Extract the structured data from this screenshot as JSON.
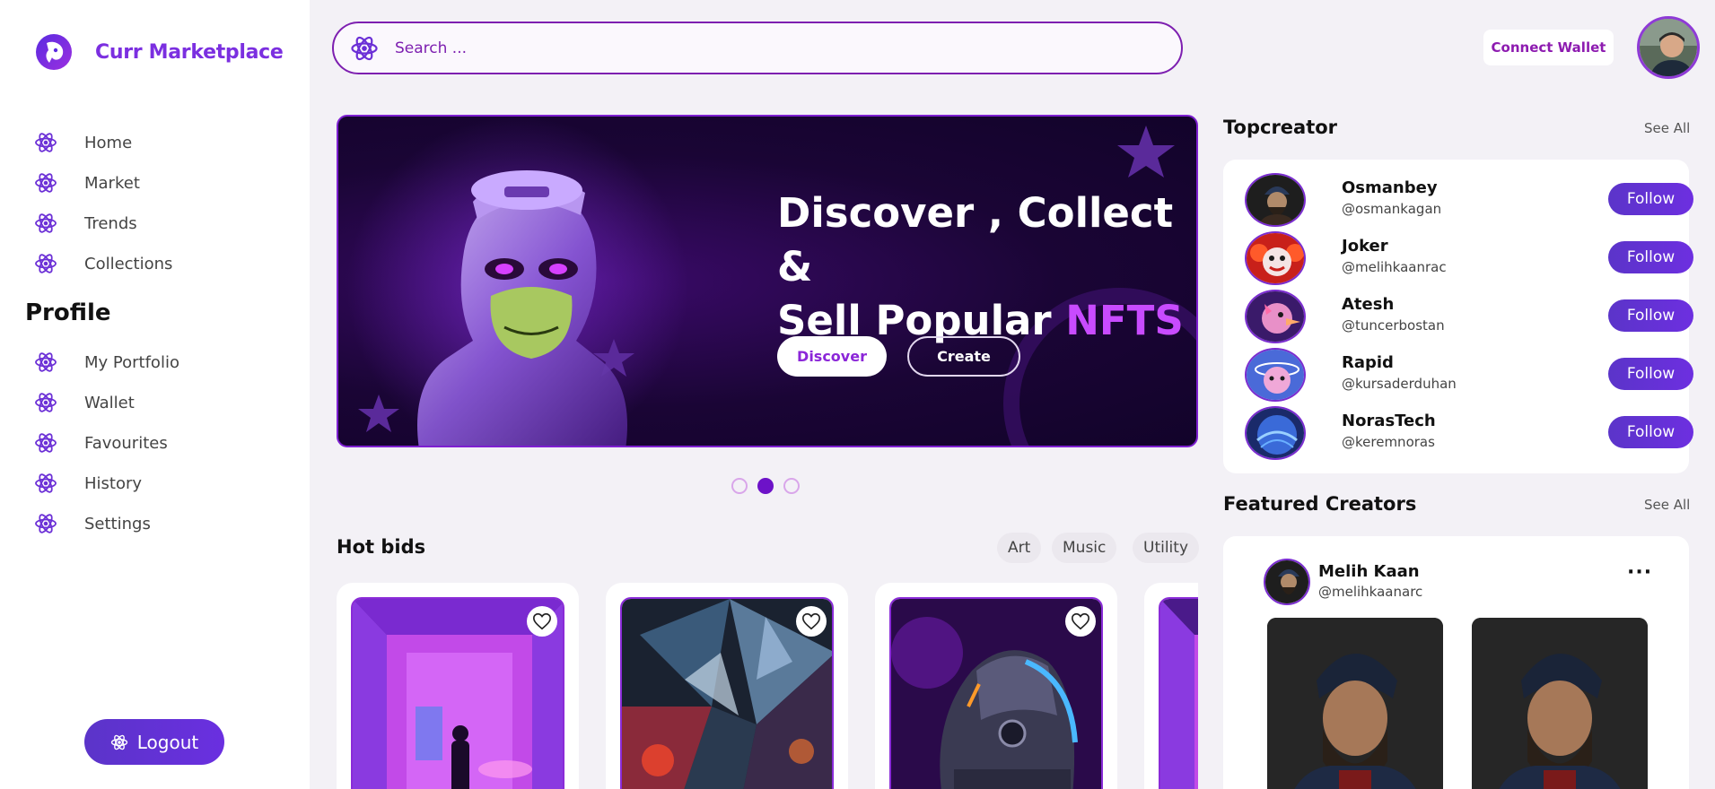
{
  "brand": {
    "name": "Curr Marketplace"
  },
  "sidebar": {
    "items": [
      {
        "label": "Home",
        "icon": "atom-icon"
      },
      {
        "label": "Market",
        "icon": "atom-icon"
      },
      {
        "label": "Trends",
        "icon": "atom-icon"
      },
      {
        "label": "Collections",
        "icon": "atom-icon"
      }
    ],
    "profile_title": "Profile",
    "profile_items": [
      {
        "label": "My Portfolio",
        "icon": "atom-icon"
      },
      {
        "label": "Wallet",
        "icon": "atom-icon"
      },
      {
        "label": "Favourites",
        "icon": "atom-icon"
      },
      {
        "label": "History",
        "icon": "atom-icon"
      },
      {
        "label": "Settings",
        "icon": "atom-icon"
      }
    ],
    "logout_label": "Logout"
  },
  "search": {
    "placeholder": "Search ..."
  },
  "header": {
    "connect_label": "Connect Wallet"
  },
  "hero": {
    "line1": "Discover , Collect &",
    "line2_main": "Sell Popular ",
    "line2_accent": "NFTS",
    "discover_label": "Discover",
    "create_label": "Create",
    "slides": 3,
    "active_slide": 2
  },
  "hot_bids": {
    "title": "Hot bids",
    "filters": [
      "Art",
      "Music",
      "Utility"
    ]
  },
  "top_creators": {
    "title": "Topcreator",
    "see_all": "See All",
    "follow_label": "Follow",
    "creators": [
      {
        "name": "Osmanbey",
        "handle": "@osmankagan"
      },
      {
        "name": "Joker",
        "handle": "@melihkaanrac"
      },
      {
        "name": "Atesh",
        "handle": "@tuncerbostan"
      },
      {
        "name": "Rapid",
        "handle": "@kursaderduhan"
      },
      {
        "name": "NorasTech",
        "handle": "@keremnoras"
      }
    ]
  },
  "featured": {
    "title": "Featured Creators",
    "see_all": "See All",
    "name": "Melih Kaan",
    "handle": "@melihkaanarc",
    "more": "···"
  },
  "colors": {
    "brand": "#7b2fe0",
    "accent": "#c84bff",
    "button": "#5b34c9",
    "background": "#f3f1f6"
  }
}
